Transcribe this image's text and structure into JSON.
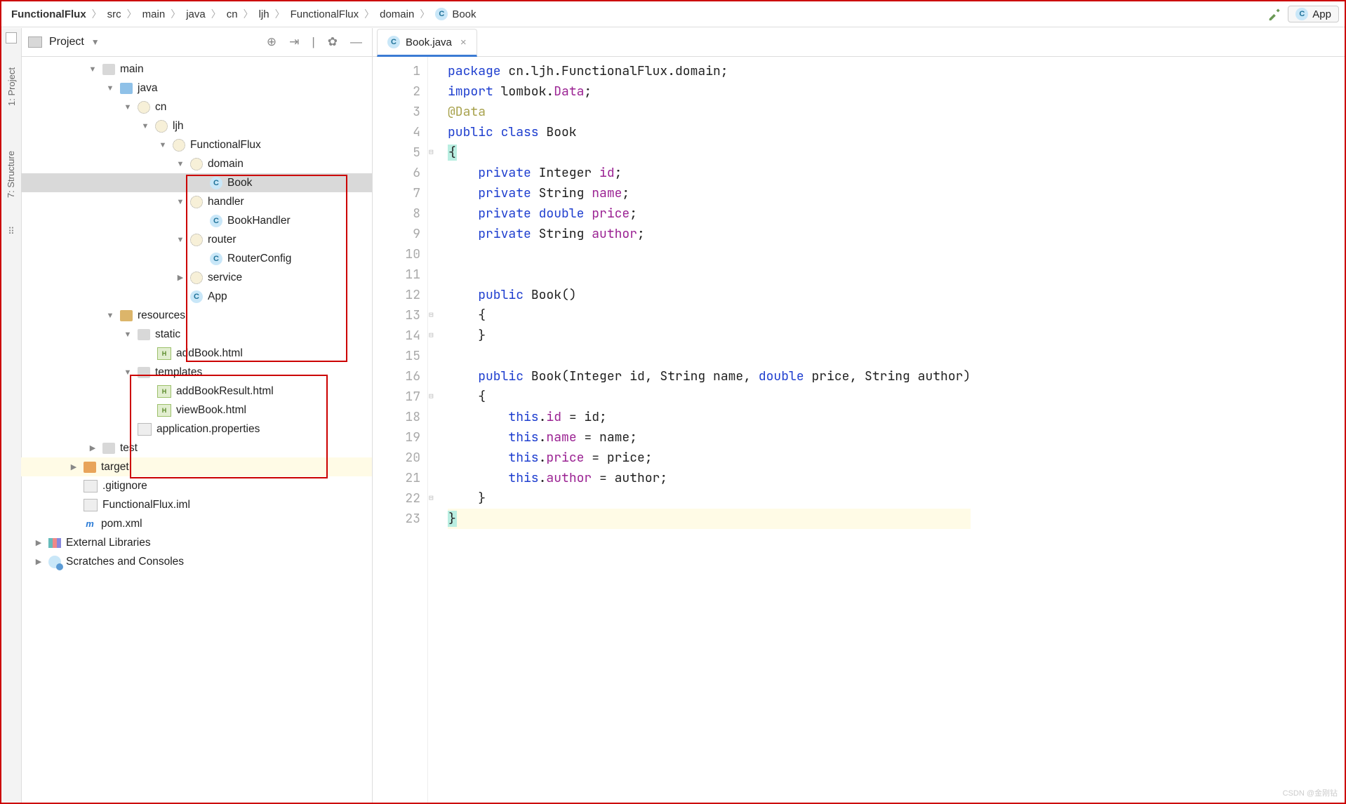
{
  "breadcrumb": [
    "FunctionalFlux",
    "src",
    "main",
    "java",
    "cn",
    "ljh",
    "FunctionalFlux",
    "domain",
    "Book"
  ],
  "breadcrumb_last_icon": "class-icon",
  "toolbar_right": {
    "app_btn": "App"
  },
  "project_panel": {
    "title": "Project"
  },
  "left_rail": {
    "project": "1: Project",
    "structure": "7: Structure"
  },
  "tree": [
    {
      "indent": 95,
      "arrow": "down",
      "icon": "fold-g",
      "label": "main"
    },
    {
      "indent": 120,
      "arrow": "down",
      "icon": "fold-b",
      "label": "java"
    },
    {
      "indent": 145,
      "arrow": "down",
      "icon": "pkg",
      "label": "cn"
    },
    {
      "indent": 170,
      "arrow": "down",
      "icon": "pkg",
      "label": "ljh"
    },
    {
      "indent": 195,
      "arrow": "down",
      "icon": "pkg",
      "label": "FunctionalFlux"
    },
    {
      "indent": 220,
      "arrow": "down",
      "icon": "pkg",
      "label": "domain"
    },
    {
      "indent": 248,
      "arrow": "",
      "icon": "class-c",
      "label": "Book",
      "sel": true
    },
    {
      "indent": 220,
      "arrow": "down",
      "icon": "pkg",
      "label": "handler"
    },
    {
      "indent": 248,
      "arrow": "",
      "icon": "class-c",
      "label": "BookHandler"
    },
    {
      "indent": 220,
      "arrow": "down",
      "icon": "pkg",
      "label": "router"
    },
    {
      "indent": 248,
      "arrow": "",
      "icon": "class-c",
      "label": "RouterConfig"
    },
    {
      "indent": 220,
      "arrow": "right",
      "icon": "pkg",
      "label": "service"
    },
    {
      "indent": 220,
      "arrow": "",
      "icon": "class-c",
      "label": "App"
    },
    {
      "indent": 120,
      "arrow": "down",
      "icon": "fold",
      "label": "resources"
    },
    {
      "indent": 145,
      "arrow": "down",
      "icon": "fold-g",
      "label": "static"
    },
    {
      "indent": 173,
      "arrow": "",
      "icon": "html-i",
      "label": "addBook.html"
    },
    {
      "indent": 145,
      "arrow": "down",
      "icon": "fold-g",
      "label": "templates"
    },
    {
      "indent": 173,
      "arrow": "",
      "icon": "html-i",
      "label": "addBookResult.html"
    },
    {
      "indent": 173,
      "arrow": "",
      "icon": "html-i",
      "label": "viewBook.html"
    },
    {
      "indent": 145,
      "arrow": "",
      "icon": "prop-i",
      "label": "application.properties"
    },
    {
      "indent": 95,
      "arrow": "right",
      "icon": "fold-g",
      "label": "test"
    },
    {
      "indent": 68,
      "arrow": "right",
      "icon": "fold-o",
      "label": "target",
      "tgt": true
    },
    {
      "indent": 68,
      "arrow": "",
      "icon": "prop-i",
      "label": ".gitignore"
    },
    {
      "indent": 68,
      "arrow": "",
      "icon": "prop-i",
      "label": "FunctionalFlux.iml"
    },
    {
      "indent": 68,
      "arrow": "",
      "icon": "m-i",
      "label": "pom.xml"
    },
    {
      "indent": 18,
      "arrow": "right",
      "icon": "lib-i",
      "label": "External Libraries"
    },
    {
      "indent": 18,
      "arrow": "right",
      "icon": "scr-i",
      "label": "Scratches and Consoles"
    }
  ],
  "editor": {
    "tab": {
      "filename": "Book.java"
    },
    "lines": [
      {
        "n": 1,
        "html": "<span class=\"kw\">package</span> cn.ljh.FunctionalFlux.domain;"
      },
      {
        "n": 2,
        "html": "<span class=\"kw\">import</span> lombok.<span class=\"id\">Data</span>;"
      },
      {
        "n": 3,
        "html": "<span class=\"ann\">@Data</span>"
      },
      {
        "n": 4,
        "html": "<span class=\"kw\">public class</span> Book"
      },
      {
        "n": 5,
        "html": "<span class=\"brace-hl\">{</span>"
      },
      {
        "n": 6,
        "html": "    <span class=\"kw\">private</span> Integer <span class=\"id\">id</span>;"
      },
      {
        "n": 7,
        "html": "    <span class=\"kw\">private</span> String <span class=\"id\">name</span>;"
      },
      {
        "n": 8,
        "html": "    <span class=\"kw\">private double</span> <span class=\"id\">price</span>;"
      },
      {
        "n": 9,
        "html": "    <span class=\"kw\">private</span> String <span class=\"id\">author</span>;"
      },
      {
        "n": 10,
        "html": ""
      },
      {
        "n": 11,
        "html": ""
      },
      {
        "n": 12,
        "html": "    <span class=\"kw\">public</span> Book()"
      },
      {
        "n": 13,
        "html": "    {"
      },
      {
        "n": 14,
        "html": "    }"
      },
      {
        "n": 15,
        "html": ""
      },
      {
        "n": 16,
        "html": "    <span class=\"kw\">public</span> Book(Integer id, String name, <span class=\"kw\">double</span> price, String author)"
      },
      {
        "n": 17,
        "html": "    {"
      },
      {
        "n": 18,
        "html": "        <span class=\"kw\">this</span>.<span class=\"id\">id</span> = id;"
      },
      {
        "n": 19,
        "html": "        <span class=\"kw\">this</span>.<span class=\"id\">name</span> = name;"
      },
      {
        "n": 20,
        "html": "        <span class=\"kw\">this</span>.<span class=\"id\">price</span> = price;"
      },
      {
        "n": 21,
        "html": "        <span class=\"kw\">this</span>.<span class=\"id\">author</span> = author;"
      },
      {
        "n": 22,
        "html": "    }"
      },
      {
        "n": 23,
        "html": "<span class=\"brace-hl\">}</span>",
        "hl": true
      }
    ]
  },
  "watermark": "CSDN @金刚钻"
}
